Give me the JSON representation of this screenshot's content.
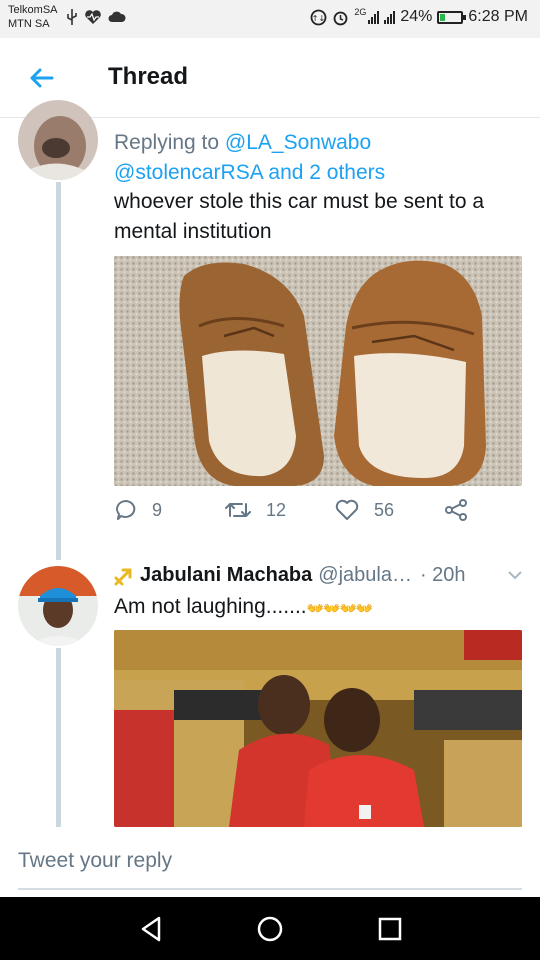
{
  "status_bar": {
    "carrier_1": "TelkomSA",
    "carrier_2": "MTN SA",
    "network_label": "2G",
    "battery": "24%",
    "battery_level": 0.24,
    "time": "6:28 PM"
  },
  "header": {
    "title": "Thread"
  },
  "tweet_1": {
    "reply_prefix": "Replying to ",
    "reply_user_1": "@LA_Sonwabo",
    "reply_user_2": "@stolencarRSA",
    "reply_suffix": " and 2 others",
    "text": "whoever stole this car must be sent to a mental institution",
    "media_alt": "photo of worn brown moccasin slippers on carpet",
    "replies": "9",
    "retweets": "12",
    "likes": "56"
  },
  "tweet_2": {
    "author_name": "Jabulani Machaba",
    "author_handle": "@jabula…",
    "time": "· 20h",
    "text": "Am not laughing.......",
    "emoji": "👐👐👐👐",
    "media_alt": "photo of two men in red laughing in parliament seats"
  },
  "reply_box": {
    "placeholder": "Tweet your reply"
  },
  "colors": {
    "accent": "#1da1f2",
    "muted": "#657786",
    "thread_line": "#ccd6dd",
    "icon_yellow": "#e8b923"
  },
  "icons": {
    "back": "arrow-left-icon",
    "reply": "reply-icon",
    "retweet": "retweet-icon",
    "like": "heart-icon",
    "share": "share-icon",
    "more": "chevron-down-icon",
    "nav_back": "nav-back-icon",
    "nav_home": "nav-home-icon",
    "nav_recents": "nav-recents-icon"
  }
}
